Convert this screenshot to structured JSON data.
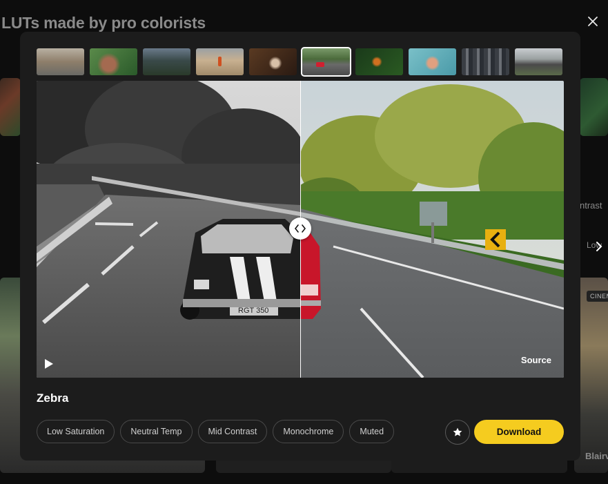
{
  "page": {
    "title": "LUTs made by pro colorists"
  },
  "background": {
    "contrast_fragment": "ntrast",
    "low_fragment": "Low",
    "badge": "CINEM",
    "name_fragment": "Blairv"
  },
  "thumbnails": [
    {
      "name": "city-street",
      "active": false
    },
    {
      "name": "portrait-grass",
      "active": false
    },
    {
      "name": "mountain-road",
      "active": false
    },
    {
      "name": "desert-figure",
      "active": false
    },
    {
      "name": "woman-phone",
      "active": false
    },
    {
      "name": "red-car-road",
      "active": true
    },
    {
      "name": "orange-flower",
      "active": false
    },
    {
      "name": "girl-teal",
      "active": false
    },
    {
      "name": "city-towers",
      "active": false
    },
    {
      "name": "highway",
      "active": false
    }
  ],
  "preview": {
    "source_label": "Source",
    "split_position": 0.5
  },
  "lut": {
    "name": "Zebra",
    "tags": [
      "Low Saturation",
      "Neutral Temp",
      "Mid Contrast",
      "Monochrome",
      "Muted"
    ]
  },
  "actions": {
    "download_label": "Download"
  },
  "colors": {
    "accent": "#f5cc1f",
    "modal_bg": "#1c1c1c",
    "page_bg": "#0d0d0d"
  },
  "icons": [
    "close-icon",
    "play-icon",
    "split-handle-icon",
    "star-icon",
    "chevron-right-icon"
  ]
}
